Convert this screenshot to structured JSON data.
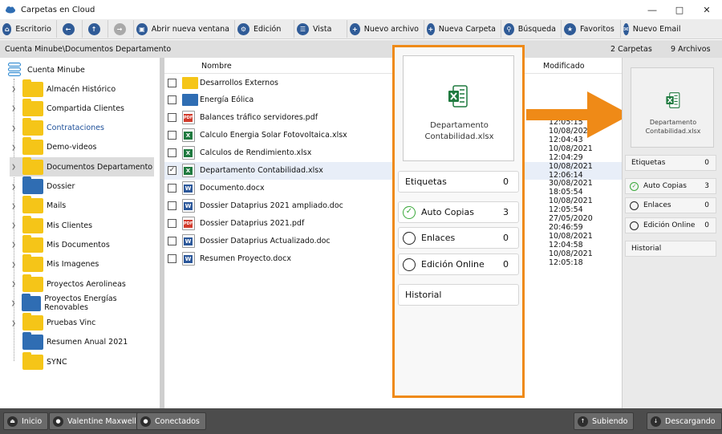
{
  "window": {
    "title": "Carpetas en Cloud"
  },
  "toolbar": {
    "buttons": [
      {
        "label": "Escritorio",
        "icon": "home-icon"
      },
      {
        "label": "",
        "icon": "back-arrow-icon"
      },
      {
        "label": "",
        "icon": "up-arrow-icon"
      },
      {
        "label": "",
        "icon": "forward-arrow-icon"
      },
      {
        "label": "Abrir nueva ventana",
        "icon": "new-window-icon"
      },
      {
        "label": "Edición",
        "icon": "gear-icon"
      },
      {
        "label": "Vista",
        "icon": "list-view-icon"
      },
      {
        "label": "Nuevo archivo",
        "icon": "plus-icon"
      },
      {
        "label": "Nueva Carpeta",
        "icon": "plus-icon"
      },
      {
        "label": "Búsqueda",
        "icon": "search-icon"
      },
      {
        "label": "Favoritos",
        "icon": "star-icon"
      },
      {
        "label": "Nuevo Email",
        "icon": "mail-icon"
      }
    ]
  },
  "pathbar": {
    "path": "Cuenta Minube\\Documentos Departamento",
    "folders": "2 Carpetas",
    "files": "9 Archivos"
  },
  "sidebar": {
    "root": "Cuenta Minube",
    "items": [
      {
        "label": "Almacén Histórico",
        "color": "yellow",
        "arrow": true
      },
      {
        "label": "Compartida Clientes",
        "color": "yellow",
        "arrow": true
      },
      {
        "label": "Contrataciones",
        "color": "yellow",
        "arrow": true,
        "link": true
      },
      {
        "label": "Demo-videos",
        "color": "yellow",
        "arrow": true
      },
      {
        "label": "Documentos Departamento",
        "color": "yellow",
        "arrow": true,
        "selected": true
      },
      {
        "label": "Dossier",
        "color": "blue",
        "arrow": true
      },
      {
        "label": "Mails",
        "color": "yellow",
        "arrow": true
      },
      {
        "label": "Mis Clientes",
        "color": "yellow",
        "arrow": true
      },
      {
        "label": "Mis Documentos",
        "color": "yellow",
        "arrow": true
      },
      {
        "label": "Mis Imagenes",
        "color": "yellow",
        "arrow": true
      },
      {
        "label": "Proyectos Aerolineas",
        "color": "yellow",
        "arrow": true
      },
      {
        "label": "Proyectos Energías Renovables",
        "color": "blue",
        "arrow": true
      },
      {
        "label": "Pruebas Vinc",
        "color": "yellow",
        "arrow": true
      },
      {
        "label": "Resumen Anual 2021",
        "color": "blue",
        "arrow": false
      },
      {
        "label": "SYNC",
        "color": "yellow",
        "arrow": false
      }
    ]
  },
  "filelist": {
    "headers": {
      "name": "Nombre",
      "modified": "Modificado"
    },
    "rows": [
      {
        "name": "Desarrollos Externos",
        "type": "folder-yellow",
        "date": ""
      },
      {
        "name": "Energía Eólica",
        "type": "folder-blue",
        "date": ""
      },
      {
        "name": "Balances tráfico servidores.pdf",
        "type": "pdf",
        "date": "10/08/2021 12:05:15"
      },
      {
        "name": "Calculo Energia Solar Fotovoltaica.xlsx",
        "type": "xlsx",
        "date": "10/08/2021 12:04:43"
      },
      {
        "name": "Calculos de Rendimiento.xlsx",
        "type": "xlsx",
        "date": "10/08/2021 12:04:29"
      },
      {
        "name": "Departamento Contabilidad.xlsx",
        "type": "xlsx",
        "date": "10/08/2021 12:06:14",
        "checked": true
      },
      {
        "name": "Documento.docx",
        "type": "docx",
        "date": "30/08/2021 18:05:54"
      },
      {
        "name": "Dossier Dataprius 2021 ampliado.doc",
        "type": "docx",
        "date": "10/08/2021 12:05:54"
      },
      {
        "name": "Dossier Dataprius 2021.pdf",
        "type": "pdf",
        "date": "27/05/2020 20:46:59"
      },
      {
        "name": "Dossier Dataprius Actualizado.doc",
        "type": "docx",
        "date": "10/08/2021 12:04:58"
      },
      {
        "name": "Resumen Proyecto.docx",
        "type": "docx",
        "date": "10/08/2021 12:05:18"
      }
    ]
  },
  "preview": {
    "name_line1": "Departamento",
    "name_line2": "Contabilidad.xlsx",
    "etiquetas": {
      "label": "Etiquetas",
      "count": "0"
    },
    "auto_copias": {
      "label": "Auto Copias",
      "count": "3"
    },
    "enlaces": {
      "label": "Enlaces",
      "count": "0"
    },
    "edicion_online": {
      "label": "Edición Online",
      "count": "0"
    },
    "historial": {
      "label": "Historial"
    }
  },
  "rpanel": {
    "name_line1": "Departamento",
    "name_line2": "Contabilidad.xlsx",
    "etiquetas": {
      "label": "Etiquetas",
      "count": "0"
    },
    "auto_copias": {
      "label": "Auto Copias",
      "count": "3"
    },
    "enlaces": {
      "label": "Enlaces",
      "count": "0"
    },
    "edicion_online": {
      "label": "Edición Online",
      "count": "0"
    },
    "historial": {
      "label": "Historial"
    }
  },
  "statusbar": {
    "inicio": "Inicio",
    "user": "Valentine Maxwell",
    "conectados": "Conectados",
    "subiendo": "Subiendo",
    "descargando": "Descargando"
  },
  "colors": {
    "highlight": "#ef8a17",
    "accent": "#2f5b97",
    "folder_yellow": "#f5c518",
    "folder_blue": "#2f6db3",
    "ok_green": "#3aa83a"
  }
}
